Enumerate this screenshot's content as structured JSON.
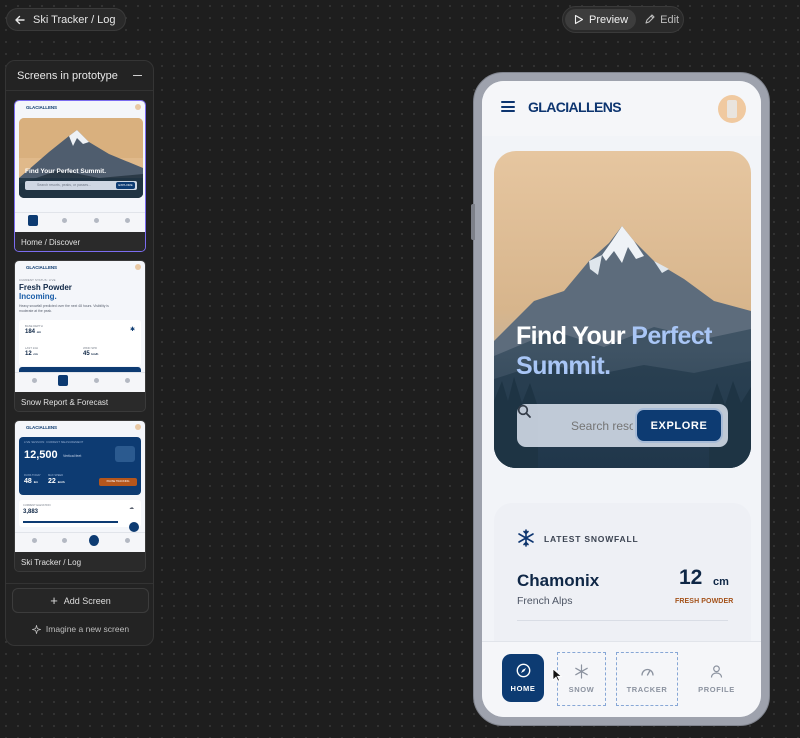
{
  "topbar": {
    "back_label": "Ski Tracker / Log",
    "preview_label": "Preview",
    "edit_label": "Edit"
  },
  "panel": {
    "title": "Screens in prototype",
    "screens": [
      {
        "label": "Home / Discover",
        "selected": true
      },
      {
        "label": "Snow Report & Forecast",
        "selected": false
      },
      {
        "label": "Ski Tracker / Log",
        "selected": false
      }
    ],
    "add_screen_label": "Add Screen",
    "imagine_label": "Imagine a new screen"
  },
  "app": {
    "brand": "GLACIALLENS",
    "hero": {
      "title_part1": "Find Your ",
      "title_accent": "Perfect Summit.",
      "search_placeholder": "Search resorts",
      "explore_label": "EXPLORE"
    },
    "snowfall": {
      "label": "LATEST SNOWFALL",
      "resort": "Chamonix",
      "region": "French Alps",
      "depth_value": "12",
      "depth_unit": "cm",
      "condition": "FRESH POWDER"
    },
    "nav": [
      {
        "label": "HOME",
        "icon": "compass-icon"
      },
      {
        "label": "SNOW",
        "icon": "snowflake-icon"
      },
      {
        "label": "TRACKER",
        "icon": "speedometer-icon"
      },
      {
        "label": "PROFILE",
        "icon": "person-icon"
      }
    ]
  },
  "thumbnails": {
    "home": {
      "brand": "GLACIALLENS",
      "title": "Find Your Perfect Summit.",
      "search": "Search resorts, peaks, or passes...",
      "button": "EXPLORE"
    },
    "snow": {
      "brand": "GLACIALLENS",
      "eyebrow": "CURRENT STATUS: LIVE",
      "title_line1": "Fresh Powder",
      "title_line2": "Incoming.",
      "body": "Heavy snowfall predicted over the next 48 hours. Visibility is moderate at the peak.",
      "stat1_label": "BASE DEPTH",
      "stat1_value": "184",
      "stat1_unit": "cm",
      "stat2_label": "LAST 24H",
      "stat2_value": "12",
      "stat2_unit": "cm",
      "stat3_label": "WIND SPD",
      "stat3_value": "45",
      "stat3_unit": "km/h"
    },
    "tracker": {
      "brand": "GLACIALLENS",
      "eyebrow": "LIVE SESSION: CURRENT MEASUREMENT",
      "big_value": "12,500",
      "big_unit": "Vertical feet",
      "stat1_label": "RUNS TODAY",
      "stat1_value": "48",
      "stat1_unit": "km",
      "stat2_label": "MAX SPEED",
      "stat2_value": "22",
      "stat2_unit": "km/h",
      "button": "PAUSE TRACKING",
      "bottom_label": "CURRENT ELEVATION",
      "bottom_value": "3,883"
    }
  },
  "colors": {
    "brand_navy": "#0d3b72",
    "accent_blue": "#a9c6f6",
    "powder_orange": "#a4521a",
    "selection_purple": "#7b6cf0"
  }
}
